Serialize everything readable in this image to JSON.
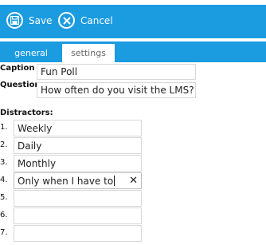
{
  "toolbar": {
    "save_label": "Save",
    "cancel_label": "Cancel",
    "accent_color": "#1b9be0"
  },
  "tabs": [
    {
      "label": "general",
      "selected": false
    },
    {
      "label": "settings",
      "selected": true
    }
  ],
  "form": {
    "caption_label": "Caption",
    "caption_value": "Fun Poll",
    "question_label": "Question",
    "question_value": "How often do you visit the LMS?",
    "distractors_label": "Distractors:",
    "distractors": [
      {
        "num": "1.",
        "value": "Weekly"
      },
      {
        "num": "2.",
        "value": "Daily"
      },
      {
        "num": "3.",
        "value": "Monthly"
      },
      {
        "num": "4.",
        "value": "Only when I have to"
      },
      {
        "num": "5.",
        "value": ""
      },
      {
        "num": "6.",
        "value": ""
      },
      {
        "num": "7.",
        "value": ""
      }
    ]
  }
}
